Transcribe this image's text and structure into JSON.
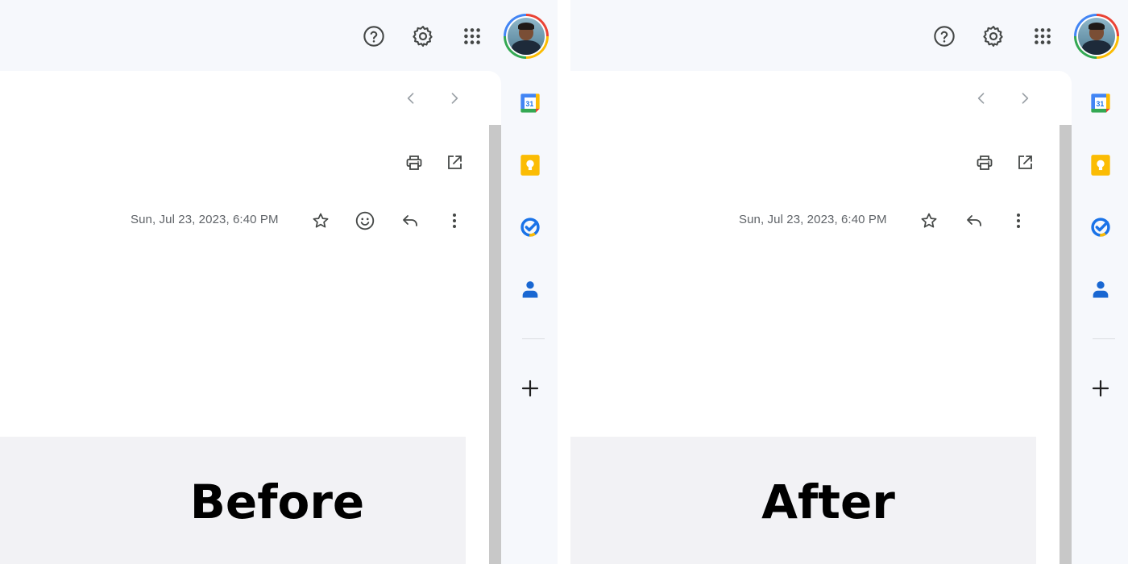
{
  "panels": {
    "before": {
      "date": "Sun, Jul 23, 2023, 6:40 PM",
      "caption": "Before",
      "actions": [
        "star-icon",
        "emoji-icon",
        "reply-icon",
        "more-icon"
      ]
    },
    "after": {
      "date": "Sun, Jul 23, 2023, 6:40 PM",
      "caption": "After",
      "actions": [
        "star-icon",
        "reply-icon",
        "more-icon"
      ]
    }
  },
  "topbar_icons": [
    "help-icon",
    "settings-icon",
    "apps-icon",
    "avatar"
  ],
  "toolbar_icons": [
    "print-icon",
    "open-in-new-window-icon"
  ],
  "side_panel": {
    "calendar_day": "31",
    "icons": [
      "calendar-icon",
      "keep-icon",
      "tasks-icon",
      "contacts-icon",
      "add-icon"
    ]
  },
  "colors": {
    "background": "#f6f8fc",
    "content": "#ffffff",
    "icon_gray": "#444746",
    "date_text": "#5f6368",
    "caption_box": "#f2f2f5",
    "keep_yellow": "#fbbc04",
    "tasks_blue": "#1a73e8",
    "contacts_blue": "#1967d2"
  }
}
